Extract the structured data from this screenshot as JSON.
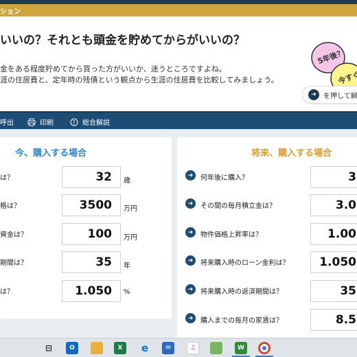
{
  "header": {
    "title_fragment": "ション"
  },
  "hero": {
    "title": "いいの？それとも頭金を貯めてからがいいの？",
    "desc1": "金をある程度貯めてから買った方がいいか、迷うところですよね。",
    "desc2": "涯の住居費と、定年時の残債という観点から生涯の住居費を比較してみましょう。",
    "button_label": "を押して解",
    "badge_text1": "5年後？",
    "badge_text2": "今すぐ"
  },
  "toolbar": {
    "items": [
      {
        "label": "呼出",
        "icon": "folder-icon"
      },
      {
        "label": "印刷",
        "icon": "printer-icon"
      },
      {
        "label": "総合解説",
        "icon": "help-icon"
      }
    ]
  },
  "left_panel": {
    "title": "今、購入する場合",
    "rows": [
      {
        "label": "は？",
        "value": "32",
        "unit": "歳"
      },
      {
        "label": "格は？",
        "value": "3500",
        "unit": "万円"
      },
      {
        "label": "資金は？",
        "value": "100",
        "unit": "万円"
      },
      {
        "label": "期間は？",
        "value": "35",
        "unit": "年"
      },
      {
        "label": "は？",
        "value": "1.050",
        "unit": "%"
      }
    ]
  },
  "right_panel": {
    "title": "将来、購入する場合",
    "rows": [
      {
        "label": "何年後に購入？",
        "value": "3"
      },
      {
        "label": "その間の毎月積立金は？",
        "value": "3.0"
      },
      {
        "label": "物件価格上昇率は？",
        "value": "1.00"
      },
      {
        "label": "将来購入時のローン金利は？",
        "value": "1.050"
      },
      {
        "label": "将来購入時の返済期間は？",
        "value": "35"
      },
      {
        "label": "購入までの毎月の家賃は？",
        "value": "8.5"
      }
    ]
  },
  "taskbar": {
    "icons": [
      "task-view-icon",
      "outlook-icon",
      "file-explorer-icon",
      "excel-icon",
      "edge-icon",
      "mail-icon",
      "itunes-icon",
      "app-icon",
      "word-helper-icon",
      "chrome-icon"
    ]
  },
  "colors": {
    "navy": "#1d4c74",
    "gold": "#d0a43d",
    "blue_title": "#2a8ad2",
    "orange_title": "#e39a2d"
  }
}
